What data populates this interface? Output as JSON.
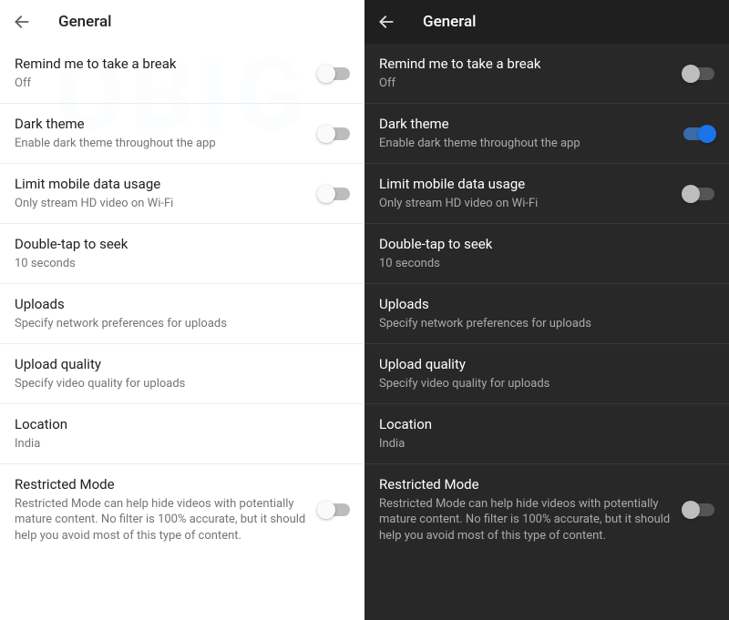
{
  "header": {
    "title": "General"
  },
  "settings": {
    "remind": {
      "title": "Remind me to take a break",
      "sub": "Off"
    },
    "darktheme": {
      "title": "Dark theme",
      "sub": "Enable dark theme throughout the app"
    },
    "limitdata": {
      "title": "Limit mobile data usage",
      "sub": "Only stream HD video on Wi-Fi"
    },
    "doubletap": {
      "title": "Double-tap to seek",
      "sub": "10 seconds"
    },
    "uploads": {
      "title": "Uploads",
      "sub": "Specify network preferences for uploads"
    },
    "uploadq": {
      "title": "Upload quality",
      "sub": "Specify video quality for uploads"
    },
    "location": {
      "title": "Location",
      "sub": "India"
    },
    "restricted": {
      "title": "Restricted Mode",
      "sub": "Restricted Mode can help hide videos with potentially mature content. No filter is 100% accurate, but it should help you avoid most of this type of content."
    }
  }
}
